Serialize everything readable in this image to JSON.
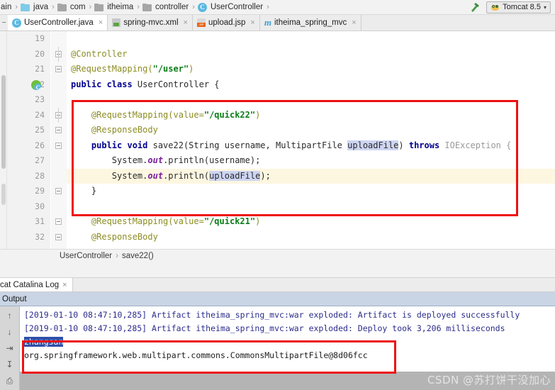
{
  "navbar": {
    "crumbs": [
      {
        "label": "ain",
        "icon": "none"
      },
      {
        "label": "java",
        "icon": "folder-blue-icon"
      },
      {
        "label": "com",
        "icon": "folder-grey-icon"
      },
      {
        "label": "itheima",
        "icon": "folder-grey-icon"
      },
      {
        "label": "controller",
        "icon": "folder-grey-icon"
      },
      {
        "label": "UserController",
        "icon": "java-class-icon"
      }
    ],
    "separator": "›",
    "build_icon": "hammer-icon",
    "run_config": {
      "label": "Tomcat 8.5",
      "icon": "tomcat-icon",
      "caret": "⌄"
    }
  },
  "editor_tabs": [
    {
      "label": "UserController.java",
      "icon": "java-class-icon",
      "close": "×",
      "active": true
    },
    {
      "label": "spring-mvc.xml",
      "icon": "xml-file-icon",
      "close": "×",
      "active": false
    },
    {
      "label": "upload.jsp",
      "icon": "jsp-file-icon",
      "close": "×",
      "active": false
    },
    {
      "label": "itheima_spring_mvc",
      "icon": "maven-module-icon",
      "close": "×",
      "active": false
    }
  ],
  "editor": {
    "lines": [
      {
        "num": "19",
        "fold": false,
        "hl": false
      },
      {
        "num": "20",
        "fold": true,
        "hl": false
      },
      {
        "num": "21",
        "fold": true,
        "hl": false
      },
      {
        "num": "22",
        "fold": false,
        "hl": false,
        "class_icon": true
      },
      {
        "num": "23",
        "fold": false,
        "hl": false
      },
      {
        "num": "24",
        "fold": true,
        "hl": false
      },
      {
        "num": "25",
        "fold": true,
        "hl": false
      },
      {
        "num": "26",
        "fold": true,
        "hl": false
      },
      {
        "num": "27",
        "fold": false,
        "hl": false
      },
      {
        "num": "28",
        "fold": false,
        "hl": true
      },
      {
        "num": "29",
        "fold": true,
        "hl": false
      },
      {
        "num": "30",
        "fold": false,
        "hl": false
      },
      {
        "num": "31",
        "fold": true,
        "hl": false
      },
      {
        "num": "32",
        "fold": true,
        "hl": false
      }
    ],
    "code": {
      "l19": "",
      "l20": "@Controller",
      "l21_ann": "@RequestMapping(",
      "l21_str": "\"/user\"",
      "l21_end": ")",
      "l22_kw": "public class ",
      "l22_name": "UserController {",
      "l23": "",
      "l24_ann": "    @RequestMapping(value=",
      "l24_str": "\"/quick22\"",
      "l24_end": ")",
      "l25": "    @ResponseBody",
      "l26_kw": "    public void ",
      "l26_sig": "save22(String username, MultipartFile ",
      "l26_param": "uploadFile",
      "l26_mid": ") ",
      "l26_throws": "throws ",
      "l26_exc": "IOException {",
      "l27": "        System.",
      "l27_field": "out",
      "l27_rest": ".println(username);",
      "l28": "        System.",
      "l28_field": "out",
      "l28_mid": ".println(",
      "l28_param": "uploadFile",
      "l28_end": ");",
      "l29": "    }",
      "l30": "",
      "l31_ann": "    @RequestMapping(value=",
      "l31_str": "\"/quick21\"",
      "l31_end": ")",
      "l32": "    @ResponseBody"
    },
    "breadcrumb": {
      "class": "UserController",
      "sep": "›",
      "method": "save22()"
    }
  },
  "tool_tabs": [
    {
      "label": "cat Catalina Log",
      "close": "×"
    }
  ],
  "output": {
    "title": "Output"
  },
  "console": {
    "toolbar_icons": [
      "scroll-up-icon",
      "scroll-down-icon",
      "soft-wrap-icon",
      "scroll-to-end-icon",
      "print-icon"
    ],
    "lines": [
      {
        "text": "[2019-01-10 08:47:10,285] Artifact itheima_spring_mvc:war exploded: Artifact is deployed successfully",
        "style": "blue"
      },
      {
        "text": "[2019-01-10 08:47:10,285] Artifact itheima_spring_mvc:war exploded: Deploy took 3,206 milliseconds",
        "style": "blue"
      },
      {
        "text": "zhangsan",
        "style": "selected"
      },
      {
        "text": "org.springframework.web.multipart.commons.CommonsMultipartFile@8d06fcc",
        "style": "dark"
      }
    ]
  },
  "watermark": {
    "text": "CSDN @苏打饼干没加心"
  },
  "colors": {
    "annotation": "#8c8c22",
    "keyword": "#00008f",
    "string": "#0a7d16",
    "highlight_row": "#fdf6e0",
    "selection": "#ced5f2",
    "redbox": "#ee1111",
    "console_text": "#2b2b8c",
    "output_header_bg": "#c9d4e4"
  }
}
